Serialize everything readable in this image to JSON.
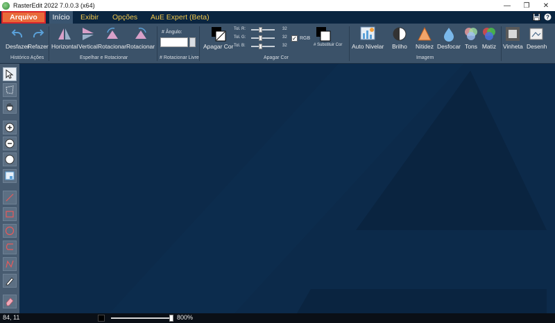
{
  "window": {
    "title": "RasterEdit 2022 7.0.0.3 (x64)",
    "controls": {
      "minimize": "—",
      "restore": "❐",
      "close": "✕"
    }
  },
  "menu": {
    "items": [
      "Arquivo",
      "Início",
      "Exibir",
      "Opções",
      "AuE Expert (Beta)"
    ],
    "active": "Início",
    "highlighted": "Arquivo"
  },
  "ribbon": {
    "groups": {
      "historico": {
        "label": "Histórico Ações",
        "buttons": [
          "Desfazer",
          "Refazer"
        ]
      },
      "espelhar": {
        "label": "Espelhar e Rotacionar",
        "buttons": [
          "Horizontal",
          "Vertical",
          "Rotacionar",
          "Rotacionar"
        ]
      },
      "rotacionar_livre": {
        "label": "# Rotacionar Livre",
        "angle_label": "# Ângulo:",
        "angle_value": ""
      },
      "apagar_cor": {
        "label": "Apagar Cor",
        "button": "Apagar Cor",
        "sliders": [
          {
            "label": "Tol. R:",
            "value": "32"
          },
          {
            "label": "Tol. G:",
            "value": "32"
          },
          {
            "label": "Tol. B:",
            "value": "32"
          }
        ],
        "rgb_label": "RGB",
        "rgb_checked": true,
        "substitute_label": "# Substituir Cor"
      },
      "imagem": {
        "label": "Imagem",
        "buttons": [
          "Auto Nivelar",
          "Brilho",
          "Nitidez",
          "Desfocar",
          "Tons",
          "Matiz",
          "Vinheta",
          "Desenh"
        ]
      }
    }
  },
  "toolbox": {
    "tools": [
      "select-arrow",
      "select-polygon",
      "pan-hand",
      "zoom-in",
      "zoom-out",
      "zoom-fit",
      "crop",
      "line",
      "rectangle",
      "ellipse",
      "freehand-curve",
      "polyline",
      "pen",
      "eraser"
    ],
    "active": "select-arrow"
  },
  "status": {
    "coords": "84, 11",
    "zoom": "800%",
    "zoom_level": 0.95
  },
  "colors": {
    "accent_menu": "#f2c94c",
    "highlight": "#e86a3a",
    "canvas": "#0c2a4a"
  }
}
